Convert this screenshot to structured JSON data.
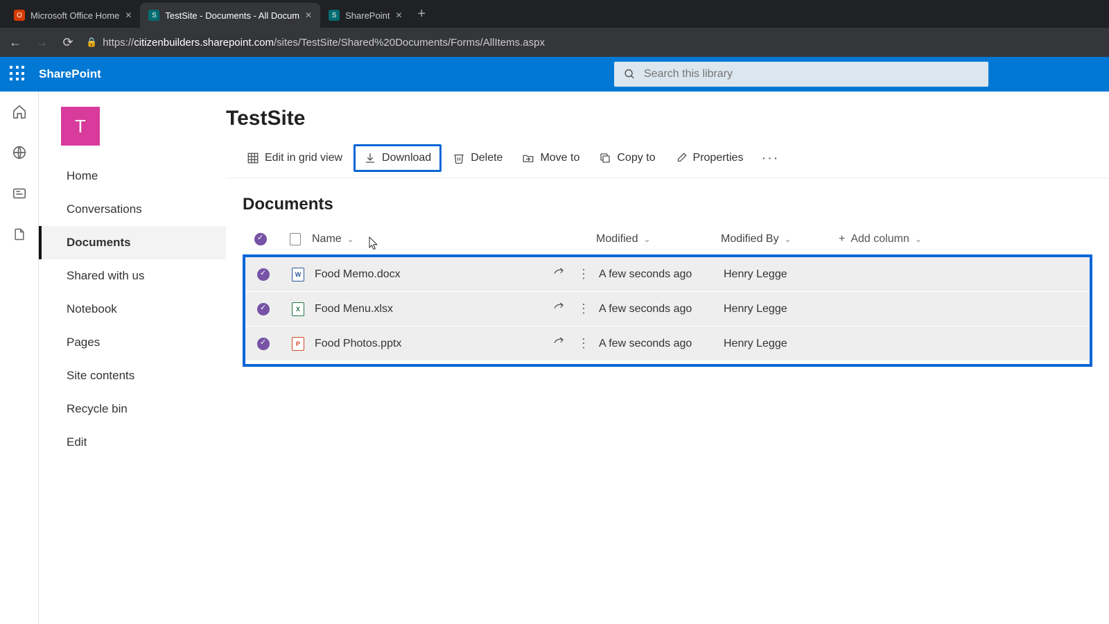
{
  "browser": {
    "tabs": [
      {
        "title": "Microsoft Office Home",
        "favicon_bg": "#d83b01",
        "favicon_letter": "O",
        "active": false
      },
      {
        "title": "TestSite - Documents - All Docum",
        "favicon_bg": "#036c70",
        "favicon_letter": "S",
        "active": true
      },
      {
        "title": "SharePoint",
        "favicon_bg": "#036c70",
        "favicon_letter": "S",
        "active": false
      }
    ],
    "url_host": "citizenbuilders.sharepoint.com",
    "url_prefix": "https://",
    "url_path": "/sites/TestSite/Shared%20Documents/Forms/AllItems.aspx"
  },
  "suite": {
    "app_name": "SharePoint",
    "search_placeholder": "Search this library"
  },
  "site": {
    "logo_letter": "T",
    "title": "TestSite",
    "nav": [
      {
        "label": "Home"
      },
      {
        "label": "Conversations"
      },
      {
        "label": "Documents",
        "active": true
      },
      {
        "label": "Shared with us"
      },
      {
        "label": "Notebook"
      },
      {
        "label": "Pages"
      },
      {
        "label": "Site contents"
      },
      {
        "label": "Recycle bin"
      },
      {
        "label": "Edit"
      }
    ]
  },
  "commands": {
    "edit_grid": "Edit in grid view",
    "download": "Download",
    "delete": "Delete",
    "move": "Move to",
    "copy": "Copy to",
    "properties": "Properties"
  },
  "library": {
    "title": "Documents",
    "columns": {
      "name": "Name",
      "modified": "Modified",
      "modified_by": "Modified By",
      "add_column": "Add column"
    },
    "rows": [
      {
        "name": "Food Memo.docx",
        "type": "word",
        "type_letter": "W",
        "modified": "A few seconds ago",
        "modified_by": "Henry Legge"
      },
      {
        "name": "Food Menu.xlsx",
        "type": "excel",
        "type_letter": "X",
        "modified": "A few seconds ago",
        "modified_by": "Henry Legge"
      },
      {
        "name": "Food Photos.pptx",
        "type": "ppt",
        "type_letter": "P",
        "modified": "A few seconds ago",
        "modified_by": "Henry Legge"
      }
    ]
  }
}
